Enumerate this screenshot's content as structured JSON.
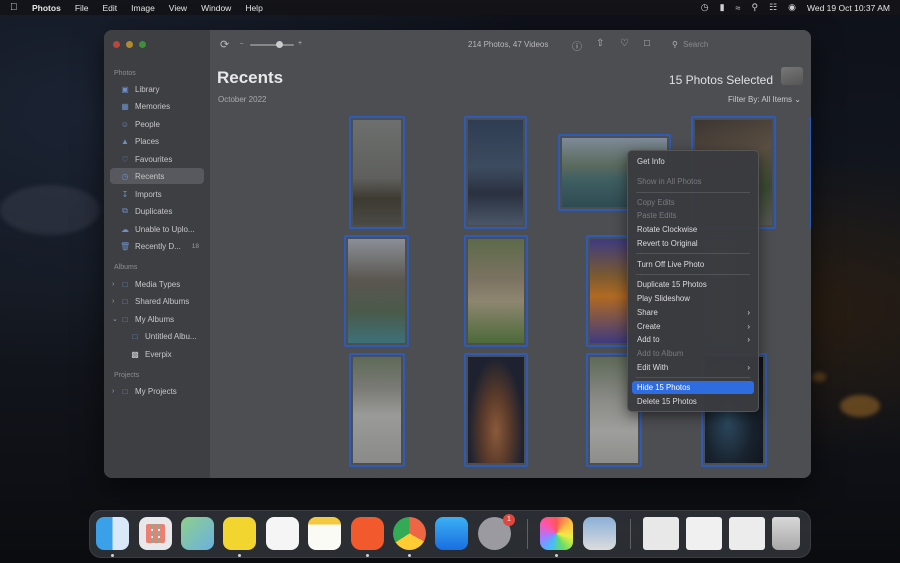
{
  "menubar": {
    "app_name": "Photos",
    "items": [
      "File",
      "Edit",
      "Image",
      "View",
      "Window",
      "Help"
    ],
    "clock": "Wed 19 Oct  10:37 AM"
  },
  "sidebar": {
    "section_photos": "Photos",
    "items": [
      {
        "label": "Library",
        "icon": "library-icon"
      },
      {
        "label": "Memories",
        "icon": "memories-icon"
      },
      {
        "label": "People",
        "icon": "people-icon"
      },
      {
        "label": "Places",
        "icon": "places-icon"
      },
      {
        "label": "Favourites",
        "icon": "heart-icon"
      },
      {
        "label": "Recents",
        "icon": "recents-icon"
      },
      {
        "label": "Imports",
        "icon": "imports-icon"
      },
      {
        "label": "Duplicates",
        "icon": "duplicates-icon"
      },
      {
        "label": "Unable to Uplo...",
        "icon": "cloud-icon"
      },
      {
        "label": "Recently D...",
        "icon": "trash-icon",
        "count": "18"
      }
    ],
    "section_albums": "Albums",
    "albums": [
      {
        "label": "Media Types"
      },
      {
        "label": "Shared Albums"
      },
      {
        "label": "My Albums"
      },
      {
        "label": "Untitled Albu..."
      },
      {
        "label": "Everpix"
      }
    ],
    "section_projects": "Projects",
    "projects": [
      {
        "label": "My Projects"
      }
    ]
  },
  "toolbar": {
    "count_label": "214 Photos, 47 Videos",
    "search_placeholder": "Search"
  },
  "main": {
    "title": "Recents",
    "subtitle": "October 2022",
    "selected_label": "15 Photos Selected",
    "filter_label": "Filter By: All Items"
  },
  "context_menu": {
    "items": [
      {
        "label": "Get Info",
        "enabled": true
      },
      {
        "label": "Show in All Photos",
        "enabled": false
      },
      {
        "label": "Copy Edits",
        "enabled": false
      },
      {
        "label": "Paste Edits",
        "enabled": false
      },
      {
        "label": "Rotate Clockwise",
        "enabled": true
      },
      {
        "label": "Revert to Original",
        "enabled": true
      },
      {
        "label": "Turn Off Live Photo",
        "enabled": true
      },
      {
        "label": "Duplicate 15 Photos",
        "enabled": true
      },
      {
        "label": "Play Slideshow",
        "enabled": true
      },
      {
        "label": "Share",
        "enabled": true,
        "submenu": true
      },
      {
        "label": "Create",
        "enabled": true,
        "submenu": true
      },
      {
        "label": "Add to",
        "enabled": true,
        "submenu": true
      },
      {
        "label": "Add to Album",
        "enabled": false
      },
      {
        "label": "Edit With",
        "enabled": true,
        "submenu": true
      },
      {
        "label": "Hide 15 Photos",
        "enabled": true,
        "highlighted": true
      },
      {
        "label": "Delete 15 Photos",
        "enabled": true
      }
    ]
  },
  "dock": {
    "apps": [
      "Finder",
      "Launchpad",
      "Maps",
      "Basecamp",
      "Reminders",
      "Notes",
      "Brave",
      "Chrome",
      "App Store",
      "System Preferences",
      "Photos",
      "Preview"
    ],
    "system_prefs_badge": "1"
  },
  "colors": {
    "accent": "#2f6ce0",
    "selection_border": "#2d5bb7"
  }
}
